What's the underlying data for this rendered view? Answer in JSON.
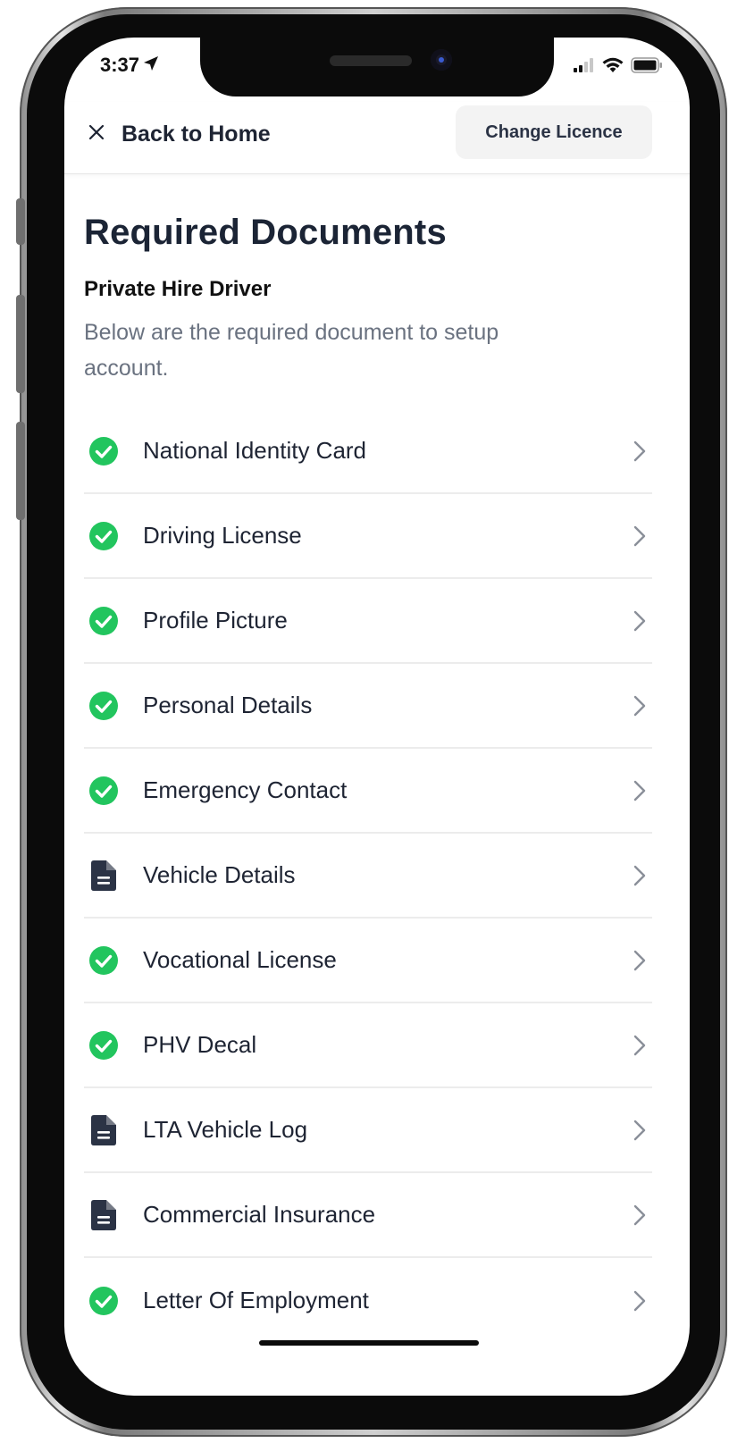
{
  "status_bar": {
    "time": "3:37",
    "location_icon": "location-arrow-icon",
    "signal_icon": "cellular-signal-icon",
    "wifi_icon": "wifi-icon",
    "battery_icon": "battery-icon"
  },
  "header": {
    "close_icon": "close-icon",
    "back_label": "Back to Home",
    "change_licence_label": "Change Licence"
  },
  "page": {
    "title": "Required Documents",
    "subtitle": "Private Hire Driver",
    "description": "Below are the required document to setup account."
  },
  "documents": [
    {
      "label": "National Identity Card",
      "status": "completed",
      "icon": "check-circle-icon"
    },
    {
      "label": "Driving License",
      "status": "completed",
      "icon": "check-circle-icon"
    },
    {
      "label": "Profile Picture",
      "status": "completed",
      "icon": "check-circle-icon"
    },
    {
      "label": "Personal Details",
      "status": "completed",
      "icon": "check-circle-icon"
    },
    {
      "label": "Emergency Contact",
      "status": "completed",
      "icon": "check-circle-icon"
    },
    {
      "label": "Vehicle Details",
      "status": "pending",
      "icon": "document-icon"
    },
    {
      "label": "Vocational License",
      "status": "completed",
      "icon": "check-circle-icon"
    },
    {
      "label": "PHV Decal",
      "status": "completed",
      "icon": "check-circle-icon"
    },
    {
      "label": "LTA Vehicle Log",
      "status": "pending",
      "icon": "document-icon"
    },
    {
      "label": "Commercial Insurance",
      "status": "pending",
      "icon": "document-icon"
    },
    {
      "label": "Letter Of Employment",
      "status": "completed",
      "icon": "check-circle-icon"
    }
  ],
  "colors": {
    "success_green": "#22c55e",
    "document_icon": "#2b3345",
    "text_primary": "#1e2433",
    "text_secondary": "#6a7280",
    "chevron": "#8a8f99"
  }
}
